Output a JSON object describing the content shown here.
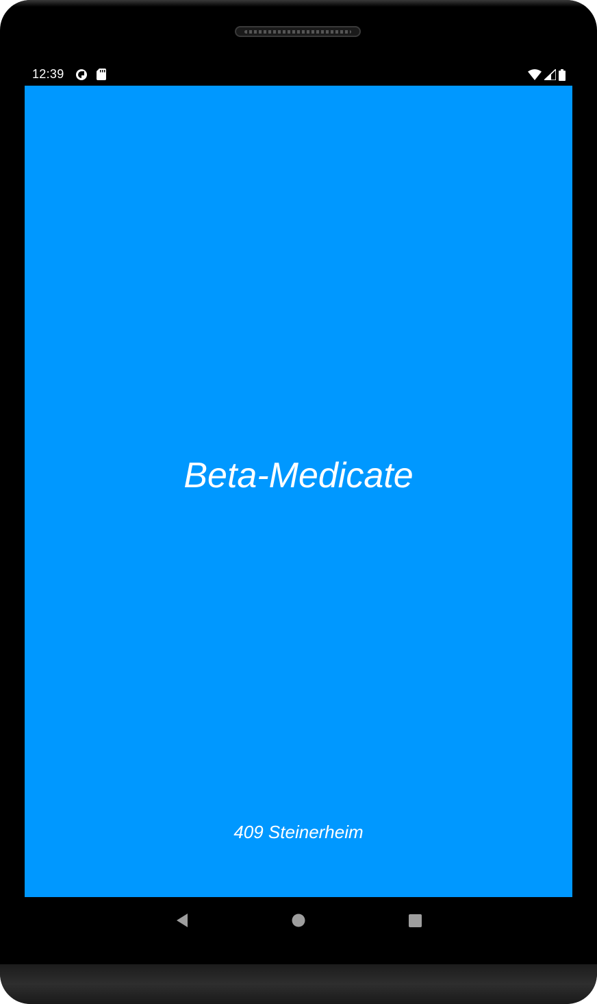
{
  "status_bar": {
    "time": "12:39",
    "left_icons": [
      "data-saver-icon",
      "sd-card-icon"
    ],
    "right_icons": [
      "wifi-icon",
      "cell-signal-icon",
      "battery-icon"
    ]
  },
  "app": {
    "title": "Beta-Medicate",
    "footer": "409 Steinerheim",
    "background_color": "#0098FF",
    "text_color": "#FFFFFF"
  },
  "nav_bar": {
    "buttons": [
      "back-icon",
      "home-icon",
      "recents-icon"
    ]
  }
}
